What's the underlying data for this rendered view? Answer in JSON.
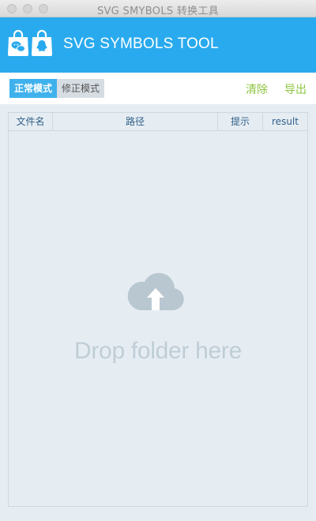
{
  "window": {
    "title": "SVG SMYBOLS 转换工具"
  },
  "header": {
    "title": "SVG SYMBOLS TOOL",
    "logo_icons": [
      "wechat-bag-icon",
      "qq-bag-icon"
    ]
  },
  "toolbar": {
    "modes": [
      {
        "label": "正常模式",
        "active": true
      },
      {
        "label": "修正模式",
        "active": false
      }
    ],
    "clear_label": "清除",
    "export_label": "导出"
  },
  "table": {
    "columns": [
      "文件名",
      "路径",
      "提示",
      "result"
    ],
    "rows": []
  },
  "dropzone": {
    "icon": "cloud-upload-icon",
    "text": "Drop folder here"
  },
  "colors": {
    "header_bg": "#29aaee",
    "active_mode_bg": "#3fb1ec",
    "action_text": "#8cc63f",
    "content_bg": "#e6edf2",
    "dropzone_text": "#bfcdd6"
  }
}
